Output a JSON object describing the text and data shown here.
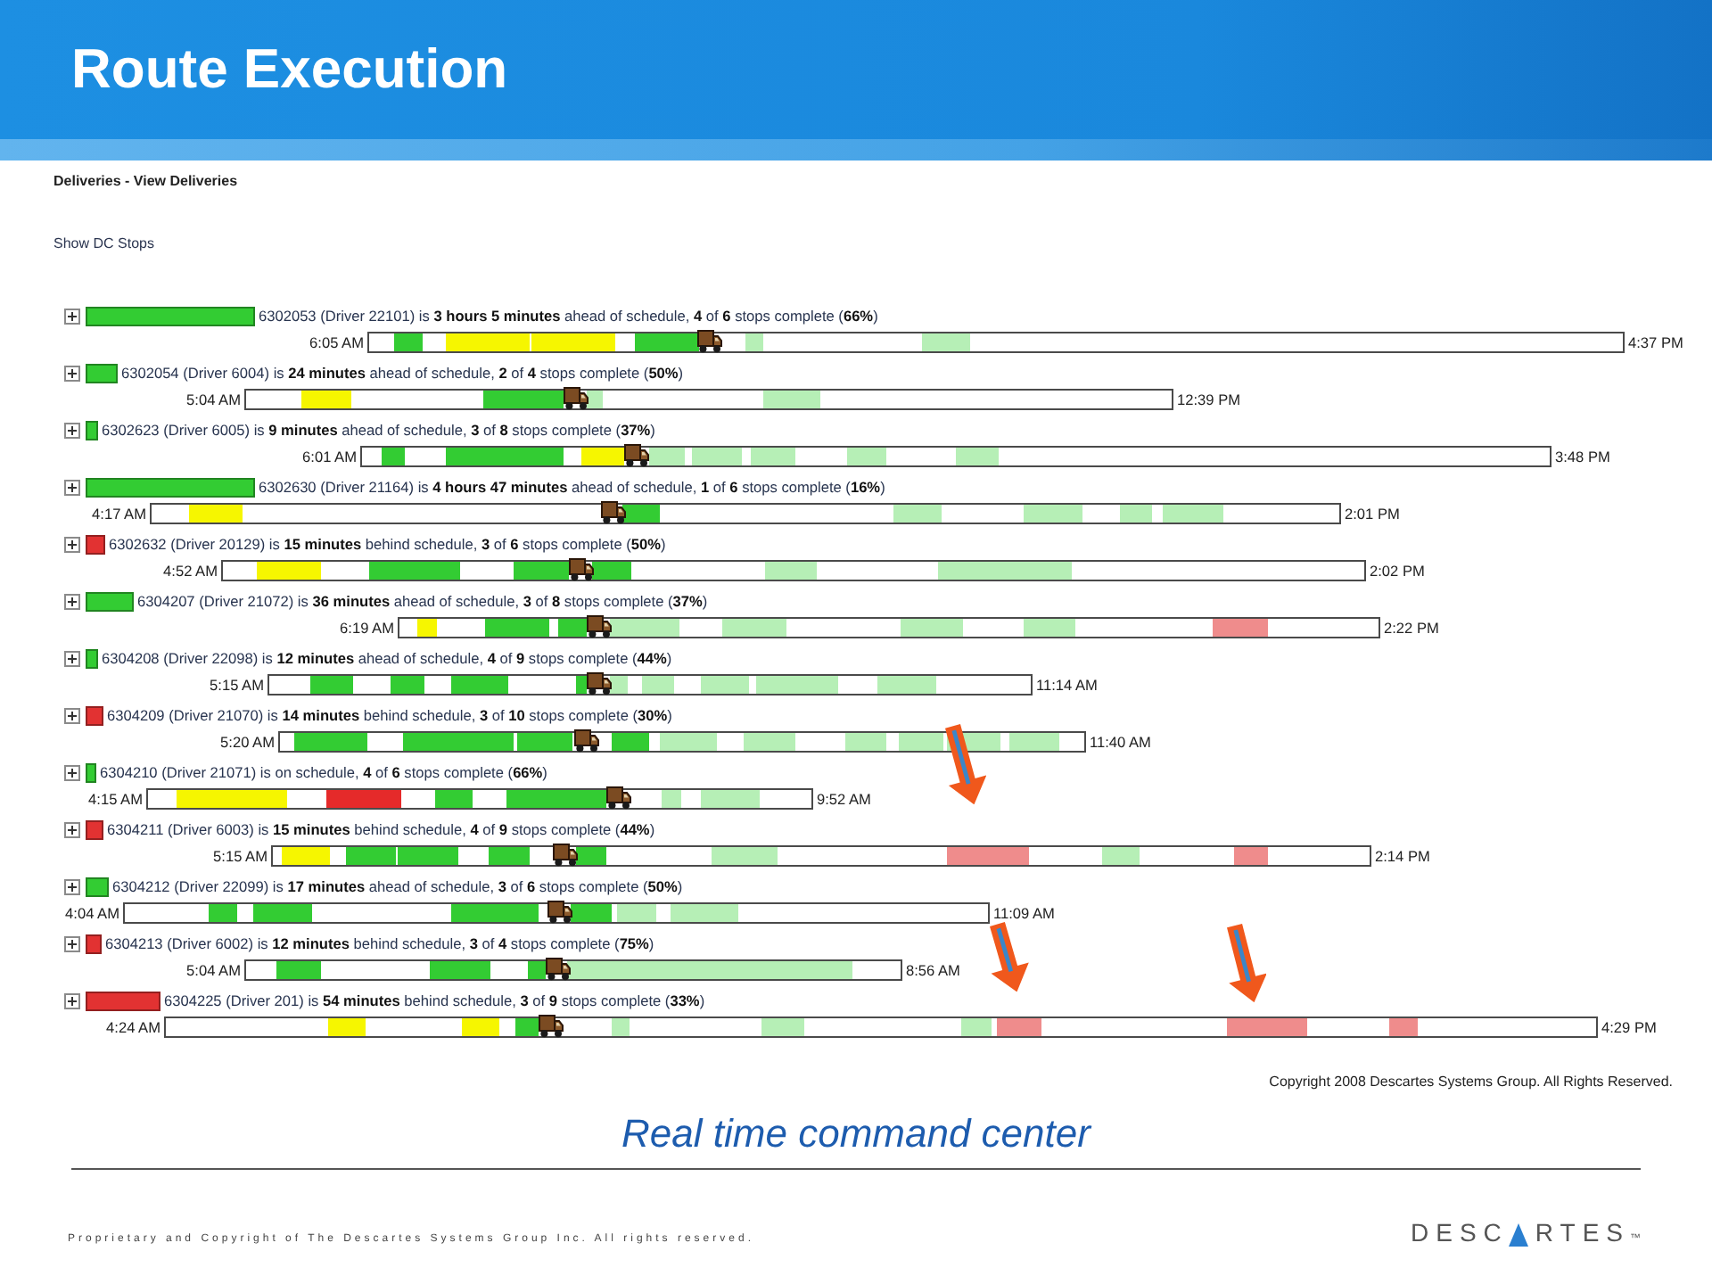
{
  "header": {
    "title": "Route Execution"
  },
  "screenshot": {
    "breadcrumb": "Deliveries - View Deliveries",
    "show_dc_stops_link": "Show DC Stops",
    "routes": [
      {
        "expanded": false,
        "color": "#33cc33",
        "summary": "6302053 (Driver 22101) is **3 hours 5 minutes** ahead of schedule, **4** of **6** stops complete (**66%**)",
        "start_time": "6:05 AM",
        "end_time": "4:37 PM",
        "segments": [
          {
            "kind": "completed"
          },
          {
            "kind": "idle"
          },
          {
            "kind": "idle"
          },
          {
            "kind": "completed"
          },
          {
            "kind": "planned"
          },
          {
            "kind": "planned"
          }
        ]
      },
      {
        "expanded": false,
        "color": "#33cc33",
        "summary": "6302054 (Driver 6004) is **24 minutes** ahead of schedule, **2** of **4** stops complete (**50%**)",
        "start_time": "5:04 AM",
        "end_time": "12:39 PM",
        "segments": [
          {
            "kind": "idle"
          },
          {
            "kind": "completed"
          },
          {
            "kind": "planned"
          },
          {
            "kind": "planned"
          }
        ]
      },
      {
        "expanded": false,
        "color": "#33cc33",
        "summary": "6302623 (Driver 6005) is **9 minutes** ahead of schedule, **3** of **8** stops complete (**37%**)",
        "start_time": "6:01 AM",
        "end_time": "3:48 PM",
        "segments": [
          {
            "kind": "completed"
          },
          {
            "kind": "completed"
          },
          {
            "kind": "idle"
          },
          {
            "kind": "planned"
          },
          {
            "kind": "planned"
          },
          {
            "kind": "planned"
          },
          {
            "kind": "planned"
          },
          {
            "kind": "planned"
          }
        ]
      },
      {
        "expanded": false,
        "color": "#33cc33",
        "summary": "6302630 (Driver 21164) is **4 hours 47 minutes** ahead of schedule, **1** of **6** stops complete (**16%**)",
        "start_time": "4:17 AM",
        "end_time": "2:01 PM",
        "segments": [
          {
            "kind": "idle"
          },
          {
            "kind": "completed"
          },
          {
            "kind": "planned"
          },
          {
            "kind": "planned"
          },
          {
            "kind": "planned"
          },
          {
            "kind": "planned"
          }
        ]
      },
      {
        "expanded": false,
        "color": "#e23232",
        "summary": "6302632 (Driver 20129) is **15 minutes** behind schedule, **3** of **6** stops complete (**50%**)",
        "start_time": "4:52 AM",
        "end_time": "2:02 PM",
        "segments": [
          {
            "kind": "idle"
          },
          {
            "kind": "completed"
          },
          {
            "kind": "completed"
          },
          {
            "kind": "completed"
          },
          {
            "kind": "planned"
          },
          {
            "kind": "planned"
          }
        ]
      },
      {
        "expanded": false,
        "color": "#33cc33",
        "summary": "6304207 (Driver 21072) is **36 minutes** ahead of schedule, **3** of **8** stops complete (**37%**)",
        "start_time": "6:19 AM",
        "end_time": "2:22 PM",
        "segments": [
          {
            "kind": "idle"
          },
          {
            "kind": "completed"
          },
          {
            "kind": "completed"
          },
          {
            "kind": "planned"
          },
          {
            "kind": "planned"
          },
          {
            "kind": "planned"
          },
          {
            "kind": "planned"
          },
          {
            "kind": "projected_late"
          }
        ]
      },
      {
        "expanded": false,
        "color": "#33cc33",
        "summary": "6304208 (Driver 22098) is **12 minutes** ahead of schedule, **4** of **9** stops complete (**44%**)",
        "start_time": "5:15 AM",
        "end_time": "11:14 AM",
        "segments": [
          {
            "kind": "completed"
          },
          {
            "kind": "completed"
          },
          {
            "kind": "completed"
          },
          {
            "kind": "completed"
          },
          {
            "kind": "planned"
          },
          {
            "kind": "planned"
          },
          {
            "kind": "planned"
          },
          {
            "kind": "planned"
          },
          {
            "kind": "planned"
          }
        ]
      },
      {
        "expanded": false,
        "color": "#e23232",
        "summary": "6304209 (Driver 21070) is **14 minutes** behind schedule, **3** of **10** stops complete (**30%**)",
        "start_time": "5:20 AM",
        "end_time": "11:40 AM",
        "segments": [
          {
            "kind": "completed"
          },
          {
            "kind": "completed"
          },
          {
            "kind": "completed"
          },
          {
            "kind": "completed"
          },
          {
            "kind": "planned"
          },
          {
            "kind": "planned"
          },
          {
            "kind": "planned"
          },
          {
            "kind": "planned"
          },
          {
            "kind": "planned"
          },
          {
            "kind": "planned"
          }
        ]
      },
      {
        "expanded": false,
        "color": "#33cc33",
        "summary": "6304210 (Driver 21071) is on schedule, **4** of **6** stops complete (**66%**)",
        "start_time": "4:15 AM",
        "end_time": "9:52 AM",
        "segments": [
          {
            "kind": "idle"
          },
          {
            "kind": "late"
          },
          {
            "kind": "completed"
          },
          {
            "kind": "completed"
          },
          {
            "kind": "planned"
          },
          {
            "kind": "planned"
          }
        ]
      },
      {
        "expanded": false,
        "color": "#e23232",
        "summary": "6304211 (Driver 6003) is **15 minutes** behind schedule, **4** of **9** stops complete (**44%**)",
        "start_time": "5:15 AM",
        "end_time": "2:14 PM",
        "segments": [
          {
            "kind": "idle"
          },
          {
            "kind": "completed"
          },
          {
            "kind": "completed"
          },
          {
            "kind": "completed"
          },
          {
            "kind": "completed"
          },
          {
            "kind": "planned"
          },
          {
            "kind": "projected_late"
          },
          {
            "kind": "planned"
          },
          {
            "kind": "projected_late"
          }
        ]
      },
      {
        "expanded": false,
        "color": "#33cc33",
        "summary": "6304212 (Driver 22099) is **17 minutes** ahead of schedule, **3** of **6** stops complete (**50%**)",
        "start_time": "4:04 AM",
        "end_time": "11:09 AM",
        "segments": [
          {
            "kind": "completed"
          },
          {
            "kind": "completed"
          },
          {
            "kind": "completed"
          },
          {
            "kind": "completed"
          },
          {
            "kind": "planned"
          },
          {
            "kind": "planned"
          }
        ]
      },
      {
        "expanded": false,
        "color": "#e23232",
        "summary": "6304213 (Driver 6002) is **12 minutes** behind schedule, **3** of **4** stops complete (**75%**)",
        "start_time": "5:04 AM",
        "end_time": "8:56 AM",
        "segments": [
          {
            "kind": "completed"
          },
          {
            "kind": "completed"
          },
          {
            "kind": "completed"
          },
          {
            "kind": "planned"
          }
        ]
      },
      {
        "expanded": false,
        "color": "#e23232",
        "summary": "6304225 (Driver 201) is **54 minutes** behind schedule, **3** of **9** stops complete (**33%**)",
        "start_time": "4:24 AM",
        "end_time": "4:29 PM",
        "segments": [
          {
            "kind": "idle"
          },
          {
            "kind": "idle"
          },
          {
            "kind": "completed"
          },
          {
            "kind": "planned"
          },
          {
            "kind": "planned"
          },
          {
            "kind": "planned"
          },
          {
            "kind": "projected_late"
          },
          {
            "kind": "projected_late"
          },
          {
            "kind": "projected_late"
          }
        ]
      }
    ],
    "copyright": "Copyright 2008 Descartes Systems Group. All Rights Reserved."
  },
  "caption": "Real time command center",
  "footer": {
    "notice": "Proprietary and Copyright of The Descartes Systems Group Inc. All rights reserved.",
    "logo": {
      "before_mark": "DESC",
      "after_mark": "RTES",
      "trademark": "™"
    }
  }
}
